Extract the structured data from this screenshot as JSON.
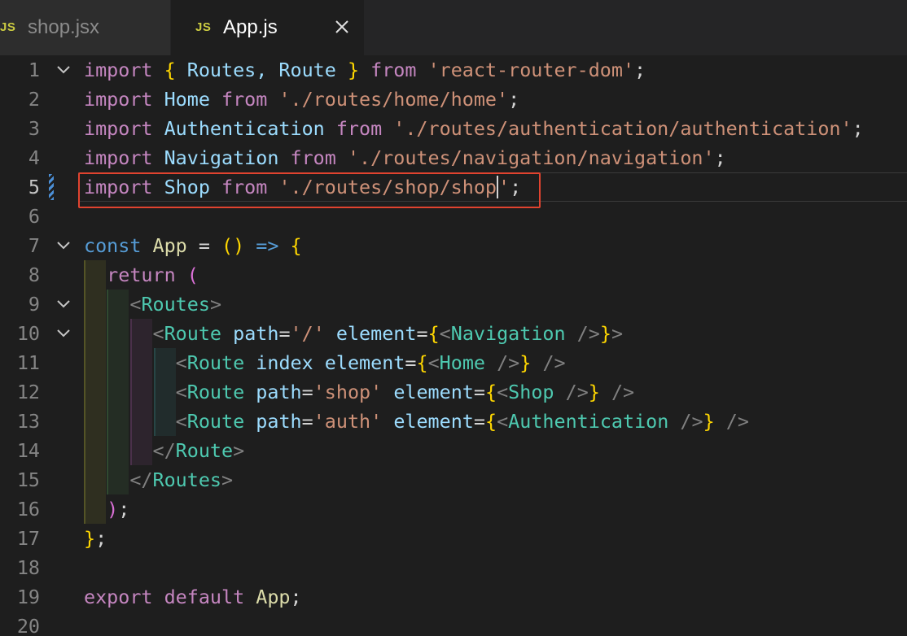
{
  "tabs": [
    {
      "icon": "JS",
      "label": "shop.jsx",
      "active": false
    },
    {
      "icon": "JS",
      "label": "App.js",
      "active": true
    }
  ],
  "lines": [
    {
      "n": "1",
      "fold": true,
      "tokens": [
        [
          "import",
          "k"
        ],
        [
          " ",
          "w"
        ],
        [
          "{",
          "p"
        ],
        [
          " Routes, Route ",
          "i"
        ],
        [
          "}",
          "p"
        ],
        [
          " ",
          "w"
        ],
        [
          "from",
          "k"
        ],
        [
          " ",
          "w"
        ],
        [
          "'react-router-dom'",
          "s"
        ],
        [
          ";",
          "w"
        ]
      ]
    },
    {
      "n": "2",
      "fold": false,
      "tokens": [
        [
          "import",
          "k"
        ],
        [
          " Home ",
          "i"
        ],
        [
          "from",
          "k"
        ],
        [
          " ",
          "w"
        ],
        [
          "'./routes/home/home'",
          "s"
        ],
        [
          ";",
          "w"
        ]
      ]
    },
    {
      "n": "3",
      "fold": false,
      "tokens": [
        [
          "import",
          "k"
        ],
        [
          " Authentication ",
          "i"
        ],
        [
          "from",
          "k"
        ],
        [
          " ",
          "w"
        ],
        [
          "'./routes/authentication/authentication'",
          "s"
        ],
        [
          ";",
          "w"
        ]
      ]
    },
    {
      "n": "4",
      "fold": false,
      "tokens": [
        [
          "import",
          "k"
        ],
        [
          " Navigation ",
          "i"
        ],
        [
          "from",
          "k"
        ],
        [
          " ",
          "w"
        ],
        [
          "'./routes/navigation/navigation'",
          "s"
        ],
        [
          ";",
          "w"
        ]
      ]
    },
    {
      "n": "5",
      "fold": false,
      "current": true,
      "tokens": [
        [
          "import",
          "k"
        ],
        [
          " Shop ",
          "i"
        ],
        [
          "from",
          "k"
        ],
        [
          " ",
          "w"
        ],
        [
          "'./routes/shop/shop",
          "s"
        ],
        [
          "|CURSOR|",
          "cursor"
        ],
        [
          "'",
          "s"
        ],
        [
          ";",
          "w"
        ]
      ]
    },
    {
      "n": "6",
      "fold": false,
      "tokens": []
    },
    {
      "n": "7",
      "fold": true,
      "tokens": [
        [
          "const",
          "b"
        ],
        [
          " ",
          "w"
        ],
        [
          "App",
          "f"
        ],
        [
          " = ",
          "w"
        ],
        [
          "()",
          "p"
        ],
        [
          " ",
          "w"
        ],
        [
          "=>",
          "b"
        ],
        [
          " ",
          "w"
        ],
        [
          "{",
          "p"
        ]
      ]
    },
    {
      "n": "8",
      "fold": false,
      "tokens": [
        [
          "  ",
          "w"
        ],
        [
          "return",
          "k"
        ],
        [
          " ",
          "w"
        ],
        [
          "(",
          "br2"
        ]
      ]
    },
    {
      "n": "9",
      "fold": true,
      "tokens": [
        [
          "    ",
          "w"
        ],
        [
          "<",
          "g"
        ],
        [
          "Routes",
          "t"
        ],
        [
          ">",
          "g"
        ]
      ]
    },
    {
      "n": "10",
      "fold": true,
      "tokens": [
        [
          "      ",
          "w"
        ],
        [
          "<",
          "g"
        ],
        [
          "Route",
          "t"
        ],
        [
          " ",
          "w"
        ],
        [
          "path",
          "i"
        ],
        [
          "=",
          "w"
        ],
        [
          "'/'",
          "s"
        ],
        [
          " ",
          "w"
        ],
        [
          "element",
          "i"
        ],
        [
          "=",
          "w"
        ],
        [
          "{",
          "p"
        ],
        [
          "<",
          "g"
        ],
        [
          "Navigation",
          "t"
        ],
        [
          " ",
          "w"
        ],
        [
          "/>",
          "g"
        ],
        [
          "}",
          "p"
        ],
        [
          ">",
          "g"
        ]
      ]
    },
    {
      "n": "11",
      "fold": false,
      "tokens": [
        [
          "        ",
          "w"
        ],
        [
          "<",
          "g"
        ],
        [
          "Route",
          "t"
        ],
        [
          " ",
          "w"
        ],
        [
          "index",
          "i"
        ],
        [
          " ",
          "w"
        ],
        [
          "element",
          "i"
        ],
        [
          "=",
          "w"
        ],
        [
          "{",
          "p"
        ],
        [
          "<",
          "g"
        ],
        [
          "Home",
          "t"
        ],
        [
          " ",
          "w"
        ],
        [
          "/>",
          "g"
        ],
        [
          "}",
          "p"
        ],
        [
          " ",
          "w"
        ],
        [
          "/>",
          "g"
        ]
      ]
    },
    {
      "n": "12",
      "fold": false,
      "tokens": [
        [
          "        ",
          "w"
        ],
        [
          "<",
          "g"
        ],
        [
          "Route",
          "t"
        ],
        [
          " ",
          "w"
        ],
        [
          "path",
          "i"
        ],
        [
          "=",
          "w"
        ],
        [
          "'shop'",
          "s"
        ],
        [
          " ",
          "w"
        ],
        [
          "element",
          "i"
        ],
        [
          "=",
          "w"
        ],
        [
          "{",
          "p"
        ],
        [
          "<",
          "g"
        ],
        [
          "Shop",
          "t"
        ],
        [
          " ",
          "w"
        ],
        [
          "/>",
          "g"
        ],
        [
          "}",
          "p"
        ],
        [
          " ",
          "w"
        ],
        [
          "/>",
          "g"
        ]
      ]
    },
    {
      "n": "13",
      "fold": false,
      "tokens": [
        [
          "        ",
          "w"
        ],
        [
          "<",
          "g"
        ],
        [
          "Route",
          "t"
        ],
        [
          " ",
          "w"
        ],
        [
          "path",
          "i"
        ],
        [
          "=",
          "w"
        ],
        [
          "'auth'",
          "s"
        ],
        [
          " ",
          "w"
        ],
        [
          "element",
          "i"
        ],
        [
          "=",
          "w"
        ],
        [
          "{",
          "p"
        ],
        [
          "<",
          "g"
        ],
        [
          "Authentication",
          "t"
        ],
        [
          " ",
          "w"
        ],
        [
          "/>",
          "g"
        ],
        [
          "}",
          "p"
        ],
        [
          " ",
          "w"
        ],
        [
          "/>",
          "g"
        ]
      ]
    },
    {
      "n": "14",
      "fold": false,
      "tokens": [
        [
          "      ",
          "w"
        ],
        [
          "</",
          "g"
        ],
        [
          "Route",
          "t"
        ],
        [
          ">",
          "g"
        ]
      ]
    },
    {
      "n": "15",
      "fold": false,
      "tokens": [
        [
          "    ",
          "w"
        ],
        [
          "</",
          "g"
        ],
        [
          "Routes",
          "t"
        ],
        [
          ">",
          "g"
        ]
      ]
    },
    {
      "n": "16",
      "fold": false,
      "tokens": [
        [
          "  ",
          "w"
        ],
        [
          ")",
          "br2"
        ],
        [
          ";",
          "w"
        ]
      ]
    },
    {
      "n": "17",
      "fold": false,
      "tokens": [
        [
          "}",
          "p"
        ],
        [
          ";",
          "w"
        ]
      ]
    },
    {
      "n": "18",
      "fold": false,
      "tokens": []
    },
    {
      "n": "19",
      "fold": false,
      "tokens": [
        [
          "export",
          "k"
        ],
        [
          " ",
          "w"
        ],
        [
          "default",
          "k"
        ],
        [
          " ",
          "w"
        ],
        [
          "App",
          "f"
        ],
        [
          ";",
          "w"
        ]
      ]
    },
    {
      "n": "20",
      "fold": false,
      "tokens": []
    }
  ]
}
